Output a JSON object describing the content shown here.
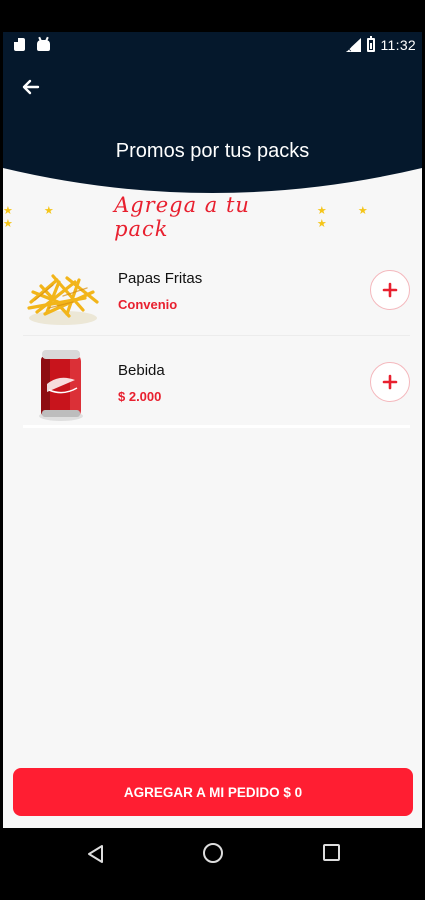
{
  "status_bar": {
    "time": "11:32"
  },
  "header": {
    "title": "Promos por tus packs"
  },
  "banner": {
    "title": "Agrega a tu pack",
    "stars_left": "★ ★ ★",
    "stars_right": "★ ★ ★"
  },
  "products": [
    {
      "name": "Papas Fritas",
      "price": "Convenio",
      "image": "french-fries"
    },
    {
      "name": "Bebida",
      "price": "$ 2.000",
      "image": "soda-can"
    }
  ],
  "footer": {
    "button_label": "AGREGAR A MI PEDIDO $ 0"
  },
  "colors": {
    "header_bg": "#05182c",
    "accent": "#ff1e32",
    "price": "#e8202f",
    "star": "#f5c518"
  }
}
